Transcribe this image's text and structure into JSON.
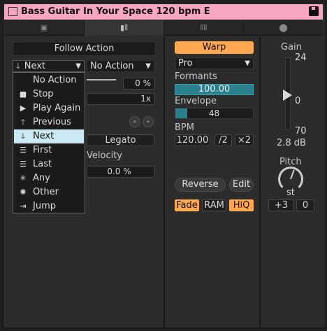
{
  "title": "Bass Guitar In Your Space 120 bpm E",
  "tabs": [
    "clip-icon",
    "audio-icon",
    "waveform-icon",
    "settings-icon"
  ],
  "follow_action": {
    "header": "Follow Action",
    "action_a": "Next",
    "action_b": "No Action",
    "chance": "0 %",
    "multiplier": "1x",
    "legato": "Legato",
    "velocity_label": "Velocity",
    "velocity_value": "0.0 %"
  },
  "menu": {
    "items": [
      {
        "label": "No Action",
        "icon": "",
        "selected": false
      },
      {
        "label": "Stop",
        "icon": "■",
        "selected": false
      },
      {
        "label": "Play Again",
        "icon": "▶",
        "selected": false
      },
      {
        "label": "Previous",
        "icon": "🡑",
        "selected": false
      },
      {
        "label": "Next",
        "icon": "🡓",
        "selected": true
      },
      {
        "label": "First",
        "icon": "☰",
        "selected": false
      },
      {
        "label": "Last",
        "icon": "☰",
        "selected": false
      },
      {
        "label": "Any",
        "icon": "✳",
        "selected": false
      },
      {
        "label": "Other",
        "icon": "✺",
        "selected": false
      },
      {
        "label": "Jump",
        "icon": "⇥",
        "selected": false
      }
    ]
  },
  "warp": {
    "warp_label": "Warp",
    "mode": "Pro",
    "formants_label": "Formants",
    "formants_value": "100.00",
    "envelope_label": "Envelope",
    "envelope_value": "48",
    "envelope_level": 0.15,
    "bpm_label": "BPM",
    "bpm_value": "120.00",
    "half": "/2",
    "double": "×2",
    "reverse": "Reverse",
    "edit": "Edit",
    "fade": "Fade",
    "ram": "RAM",
    "hiq": "HiQ"
  },
  "gain": {
    "label": "Gain",
    "top": "24",
    "mid": "0",
    "bottom": "70",
    "value": "2.8 dB"
  },
  "pitch": {
    "label": "Pitch",
    "unit": "st",
    "semitones": "+3",
    "cents": "0"
  },
  "colors": {
    "title_bg": "#f6a6c1",
    "orange": "#ffa850",
    "teal": "#2a7f8c",
    "selected": "#cbe9f3"
  }
}
